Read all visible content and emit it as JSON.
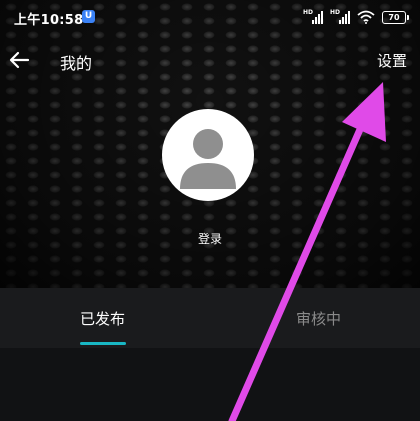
{
  "status_bar": {
    "time": "上午10:58",
    "app_badge": "U",
    "battery": "70"
  },
  "navbar": {
    "title": "我的",
    "settings": "设置"
  },
  "profile": {
    "login_label": "登录"
  },
  "tabs": [
    {
      "label": "已发布",
      "active": true
    },
    {
      "label": "审核中",
      "active": false
    }
  ],
  "colors": {
    "accent": "#19b7c4",
    "annotation_arrow": "#e04ae8"
  }
}
